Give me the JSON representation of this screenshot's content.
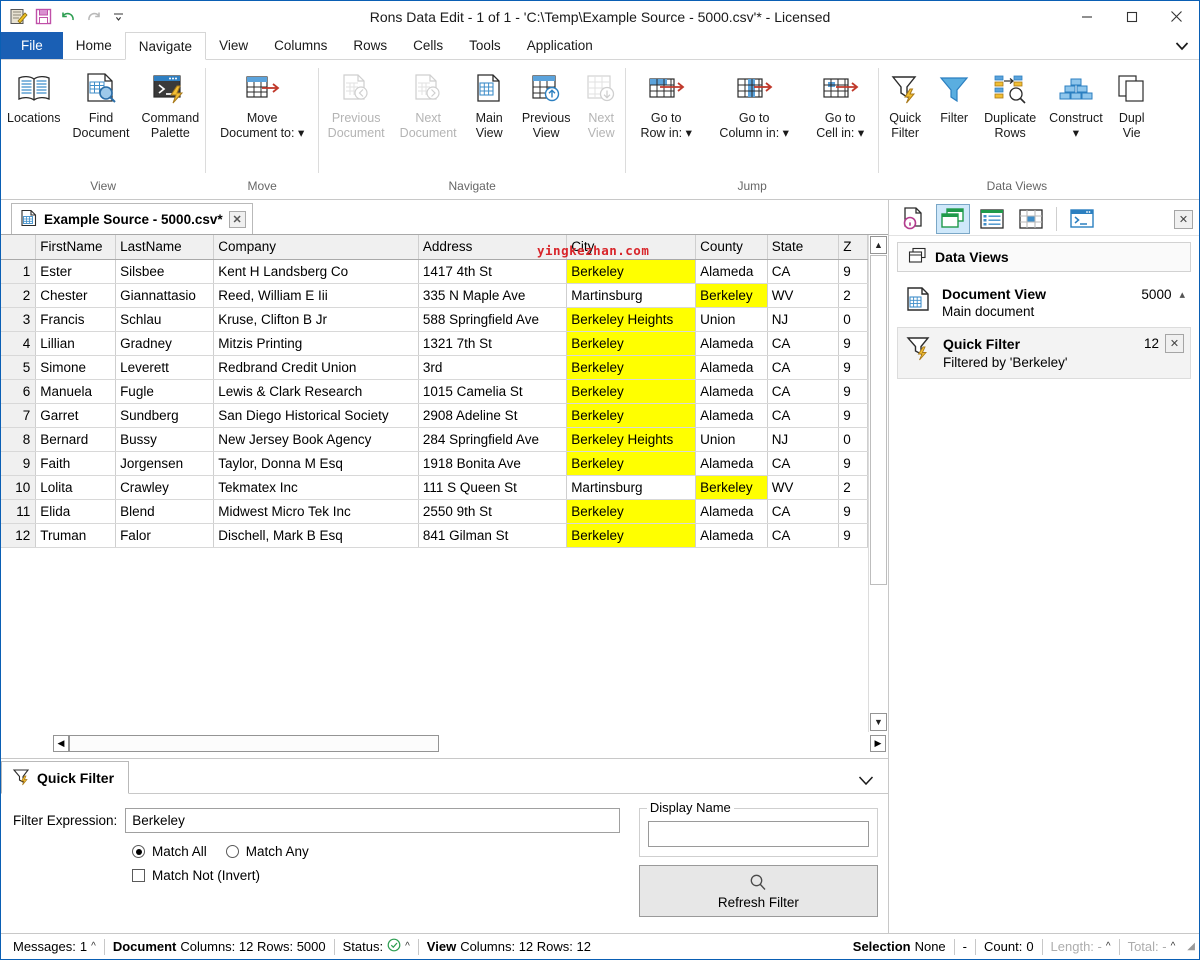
{
  "window": {
    "title": "Rons Data Edit - 1 of 1 - 'C:\\Temp\\Example Source - 5000.csv'* - Licensed",
    "minimize_label": "—",
    "maximize_label": "□",
    "close_label": "✕"
  },
  "quick_access": {
    "items": [
      {
        "name": "edit-document-icon",
        "label": ""
      },
      {
        "name": "save-icon",
        "label": ""
      },
      {
        "name": "undo-icon",
        "label": ""
      },
      {
        "name": "redo-icon",
        "label": ""
      },
      {
        "name": "customize-qat-icon",
        "label": "▾"
      }
    ]
  },
  "ribbon": {
    "tabs": [
      {
        "id": "file",
        "label": "File"
      },
      {
        "id": "home",
        "label": "Home"
      },
      {
        "id": "navigate",
        "label": "Navigate"
      },
      {
        "id": "view",
        "label": "View"
      },
      {
        "id": "columns",
        "label": "Columns"
      },
      {
        "id": "rows",
        "label": "Rows"
      },
      {
        "id": "cells",
        "label": "Cells"
      },
      {
        "id": "tools",
        "label": "Tools"
      },
      {
        "id": "application",
        "label": "Application"
      }
    ],
    "active_tab": "Navigate",
    "collapse_icon": "chevron-down-icon",
    "groups": [
      {
        "label": "View",
        "buttons": [
          {
            "label": "Locations",
            "icon": "book-icon",
            "enabled": true
          },
          {
            "label": "Find\nDocument",
            "icon": "find-document-icon",
            "enabled": true
          },
          {
            "label": "Command\nPalette",
            "icon": "command-palette-icon",
            "enabled": true
          }
        ]
      },
      {
        "label": "Move",
        "buttons": [
          {
            "label": "Move\nDocument to: ▾",
            "icon": "move-document-icon",
            "enabled": true
          }
        ]
      },
      {
        "label": "Navigate",
        "buttons": [
          {
            "label": "Previous\nDocument",
            "icon": "previous-document-icon",
            "enabled": false
          },
          {
            "label": "Next\nDocument",
            "icon": "next-document-icon",
            "enabled": false
          },
          {
            "label": "Main\nView",
            "icon": "main-view-icon",
            "enabled": true
          },
          {
            "label": "Previous\nView",
            "icon": "previous-view-icon",
            "enabled": true
          },
          {
            "label": "Next\nView",
            "icon": "next-view-icon",
            "enabled": false
          }
        ]
      },
      {
        "label": "Jump",
        "buttons": [
          {
            "label": "Go to\nRow in: ▾",
            "icon": "goto-row-icon",
            "enabled": true
          },
          {
            "label": "Go to\nColumn in: ▾",
            "icon": "goto-column-icon",
            "enabled": true
          },
          {
            "label": "Go to\nCell in: ▾",
            "icon": "goto-cell-icon",
            "enabled": true
          }
        ]
      },
      {
        "label": "Data Views",
        "buttons": [
          {
            "label": "Quick\nFilter",
            "icon": "quick-filter-icon",
            "enabled": true
          },
          {
            "label": "Filter",
            "icon": "filter-icon",
            "enabled": true
          },
          {
            "label": "Duplicate\nRows",
            "icon": "duplicate-rows-icon",
            "enabled": true
          },
          {
            "label": "Construct\n▾",
            "icon": "construct-icon",
            "enabled": true
          },
          {
            "label": "Dupl\nVie",
            "icon": "duplicate-view-icon",
            "enabled": true
          }
        ]
      }
    ]
  },
  "document_tab": {
    "label": "Example Source - 5000.csv*",
    "icon": "document-grid-icon",
    "close_label": "✕"
  },
  "grid": {
    "columns": [
      "",
      "FirstName",
      "LastName",
      "Company",
      "Address",
      "City",
      "County",
      "State",
      "Z"
    ],
    "rows": [
      {
        "n": "1",
        "first": "Ester",
        "last": "Silsbee",
        "company": "Kent H Landsberg Co",
        "address": "1417 4th St",
        "city": "Berkeley",
        "county": "Alameda",
        "state": "CA",
        "z": "9",
        "hl": "city"
      },
      {
        "n": "2",
        "first": "Chester",
        "last": "Giannattasio",
        "company": "Reed, William E Iii",
        "address": "335 N Maple Ave",
        "city": "Martinsburg",
        "county": "Berkeley",
        "state": "WV",
        "z": "2",
        "hl": "county"
      },
      {
        "n": "3",
        "first": "Francis",
        "last": "Schlau",
        "company": "Kruse, Clifton B Jr",
        "address": "588 Springfield Ave",
        "city": "Berkeley Heights",
        "county": "Union",
        "state": "NJ",
        "z": "0",
        "hl": "city"
      },
      {
        "n": "4",
        "first": "Lillian",
        "last": "Gradney",
        "company": "Mitzis Printing",
        "address": "1321 7th St",
        "city": "Berkeley",
        "county": "Alameda",
        "state": "CA",
        "z": "9",
        "hl": "city"
      },
      {
        "n": "5",
        "first": "Simone",
        "last": "Leverett",
        "company": "Redbrand Credit Union",
        "address": "3rd",
        "city": "Berkeley",
        "county": "Alameda",
        "state": "CA",
        "z": "9",
        "hl": "city"
      },
      {
        "n": "6",
        "first": "Manuela",
        "last": "Fugle",
        "company": "Lewis & Clark Research",
        "address": "1015 Camelia St",
        "city": "Berkeley",
        "county": "Alameda",
        "state": "CA",
        "z": "9",
        "hl": "city"
      },
      {
        "n": "7",
        "first": "Garret",
        "last": "Sundberg",
        "company": "San Diego Historical Society",
        "address": "2908 Adeline St",
        "city": "Berkeley",
        "county": "Alameda",
        "state": "CA",
        "z": "9",
        "hl": "city"
      },
      {
        "n": "8",
        "first": "Bernard",
        "last": "Bussy",
        "company": "New Jersey Book Agency",
        "address": "284 Springfield Ave",
        "city": "Berkeley Heights",
        "county": "Union",
        "state": "NJ",
        "z": "0",
        "hl": "city"
      },
      {
        "n": "9",
        "first": "Faith",
        "last": "Jorgensen",
        "company": "Taylor, Donna M Esq",
        "address": "1918 Bonita Ave",
        "city": "Berkeley",
        "county": "Alameda",
        "state": "CA",
        "z": "9",
        "hl": "city"
      },
      {
        "n": "10",
        "first": "Lolita",
        "last": "Crawley",
        "company": "Tekmatex Inc",
        "address": "111 S Queen St",
        "city": "Martinsburg",
        "county": "Berkeley",
        "state": "WV",
        "z": "2",
        "hl": "county"
      },
      {
        "n": "11",
        "first": "Elida",
        "last": "Blend",
        "company": "Midwest Micro Tek Inc",
        "address": "2550 9th St",
        "city": "Berkeley",
        "county": "Alameda",
        "state": "CA",
        "z": "9",
        "hl": "city"
      },
      {
        "n": "12",
        "first": "Truman",
        "last": "Falor",
        "company": "Dischell, Mark B Esq",
        "address": "841 Gilman St",
        "city": "Berkeley",
        "county": "Alameda",
        "state": "CA",
        "z": "9",
        "hl": "city"
      }
    ]
  },
  "watermark": {
    "text": "yingkezhan.com",
    "color": "#d8252a"
  },
  "quick_filter_panel": {
    "tab_label": "Quick Filter",
    "tab_icon": "quick-filter-icon",
    "collapse_icon": "chevron-down-icon",
    "filter_expression_label": "Filter Expression:",
    "filter_expression_value": "Berkeley",
    "match_all_label": "Match All",
    "match_any_label": "Match Any",
    "match_all_selected": true,
    "match_not_label": "Match Not (Invert)",
    "match_not_checked": false,
    "display_name_label": "Display Name",
    "display_name_value": "",
    "refresh_label": "Refresh Filter",
    "refresh_icon": "search-icon"
  },
  "side_panel": {
    "close_label": "✕",
    "tools": [
      {
        "name": "document-info-icon",
        "selected": false
      },
      {
        "name": "data-views-icon",
        "selected": true
      },
      {
        "name": "list-view-icon",
        "selected": false
      },
      {
        "name": "cell-view-icon",
        "selected": false
      },
      {
        "name": "console-icon",
        "selected": false
      }
    ],
    "header": "Data Views",
    "header_icon": "data-views-icon",
    "items": [
      {
        "name": "Document View",
        "subtitle": "Main document",
        "count": "5000",
        "icon": "document-grid-icon",
        "selected": false,
        "collapse": "▴",
        "closable": false
      },
      {
        "name": "Quick Filter",
        "subtitle": "Filtered by 'Berkeley'",
        "count": "12",
        "icon": "quick-filter-icon",
        "selected": true,
        "closable": true,
        "close_label": "✕"
      }
    ]
  },
  "status_bar": {
    "messages_label": "Messages:",
    "messages_value": "1",
    "document_label": "Document",
    "document_value": "Columns: 12 Rows: 5000",
    "status_label": "Status:",
    "status_icon": "check-circle-icon",
    "view_label": "View",
    "view_value": "Columns: 12 Rows: 12",
    "selection_label": "Selection",
    "selection_value": "None",
    "dash": "-",
    "count_label": "Count:",
    "count_value": "0",
    "length_label": "Length: -",
    "total_label": "Total: -"
  },
  "scrollbars": {
    "v_up": "▲",
    "v_down": "▼",
    "h_left": "◀",
    "h_right": "▶"
  }
}
